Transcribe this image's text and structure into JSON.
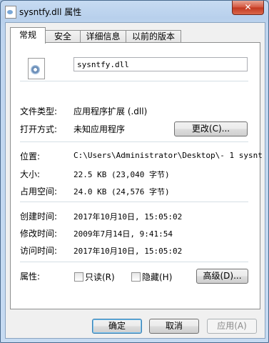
{
  "window": {
    "title": "sysntfy.dll 属性",
    "close_symbol": "✕"
  },
  "tabs": [
    {
      "label": "常规",
      "active": true
    },
    {
      "label": "安全",
      "active": false
    },
    {
      "label": "详细信息",
      "active": false
    },
    {
      "label": "以前的版本",
      "active": false
    }
  ],
  "general": {
    "icon": "dll-file-icon",
    "file_name": "sysntfy.dll",
    "file_type_label": "文件类型:",
    "file_type_value": "应用程序扩展 (.dll)",
    "opens_with_label": "打开方式:",
    "opens_with_value": "未知应用程序",
    "change_button": "更改(C)...",
    "location_label": "位置:",
    "location_value": "C:\\Users\\Administrator\\Desktop\\-  1 sysnt",
    "size_label": "大小:",
    "size_value": "22.5 KB (23,040 字节)",
    "size_on_disk_label": "占用空间:",
    "size_on_disk_value": "24.0 KB (24,576 字节)",
    "created_label": "创建时间:",
    "created_value": "2017年10月10日, 15:05:02",
    "modified_label": "修改时间:",
    "modified_value": "2009年7月14日, 9:41:54",
    "accessed_label": "访问时间:",
    "accessed_value": "2017年10月10日, 15:05:02",
    "attributes_label": "属性:",
    "readonly_label": "只读(R)",
    "readonly_checked": false,
    "hidden_label": "隐藏(H)",
    "hidden_checked": false,
    "advanced_button": "高级(D)..."
  },
  "footer": {
    "ok_button": "确定",
    "cancel_button": "取消",
    "apply_button": "应用(A)"
  }
}
